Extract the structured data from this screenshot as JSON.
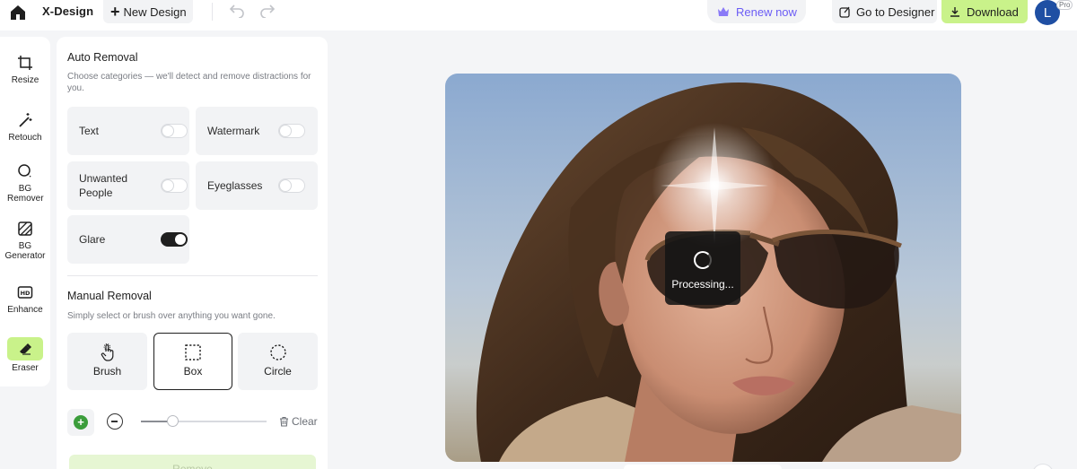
{
  "topbar": {
    "brand": "X-Design",
    "new_design_label": "New Design",
    "renew_label": "Renew now",
    "goto_designer_label": "Go to Designer",
    "download_label": "Download",
    "avatar_initial": "L",
    "pro_badge": "Pro"
  },
  "tools": [
    {
      "label": "Resize",
      "icon": "crop-icon"
    },
    {
      "label": "Retouch",
      "icon": "magic-wand-icon"
    },
    {
      "label": "BG Remover",
      "icon": "bg-remover-icon"
    },
    {
      "label": "BG Generator",
      "icon": "hatch-square-icon"
    },
    {
      "label": "Enhance",
      "icon": "hd-icon"
    },
    {
      "label": "Eraser",
      "icon": "eraser-icon",
      "active": true
    }
  ],
  "auto_removal": {
    "title": "Auto Removal",
    "description": "Choose categories — we'll detect and remove distractions for you.",
    "options": [
      {
        "label": "Text",
        "on": false
      },
      {
        "label": "Watermark",
        "on": false
      },
      {
        "label": "Unwanted People",
        "on": false
      },
      {
        "label": "Eyeglasses",
        "on": false
      },
      {
        "label": "Glare",
        "on": true
      }
    ]
  },
  "manual_removal": {
    "title": "Manual Removal",
    "description": "Simply select or brush over anything you want gone.",
    "modes": [
      {
        "label": "Brush",
        "icon": "hand-pointer-icon",
        "selected": false
      },
      {
        "label": "Box",
        "icon": "dashed-square-icon",
        "selected": true
      },
      {
        "label": "Circle",
        "icon": "dashed-circle-icon",
        "selected": false
      }
    ],
    "brush_size": 0.25,
    "clear_label": "Clear",
    "remove_label": "Remove"
  },
  "canvas": {
    "status_label": "Processing..."
  },
  "colors": {
    "accent": "#c9f28a",
    "renew": "#6b5cf5",
    "avatar": "#1f4fa3"
  }
}
